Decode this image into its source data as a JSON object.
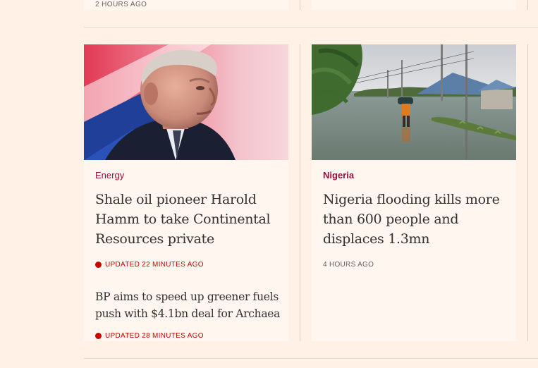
{
  "top_strip": {
    "time": "2 HOURS AGO"
  },
  "cards": [
    {
      "tag": "Energy",
      "headline": "Shale oil pioneer Harold Hamm to take Continental Resources private",
      "updated": "UPDATED 22 MINUTES AGO",
      "sub_headline": "BP aims to speed up greener fuels push with $4.1bn deal for Archaea",
      "sub_updated": "UPDATED 28 MINUTES AGO"
    },
    {
      "tag": "Nigeria",
      "headline": "Nigeria flooding kills more than 600 people and displaces 1.3mn",
      "time": "4 HOURS AGO"
    }
  ],
  "colors": {
    "background": "#fff1e5",
    "card": "#fff7ef",
    "tag": "#990f3d",
    "updated_red": "#cc0000",
    "text": "#33302e"
  }
}
